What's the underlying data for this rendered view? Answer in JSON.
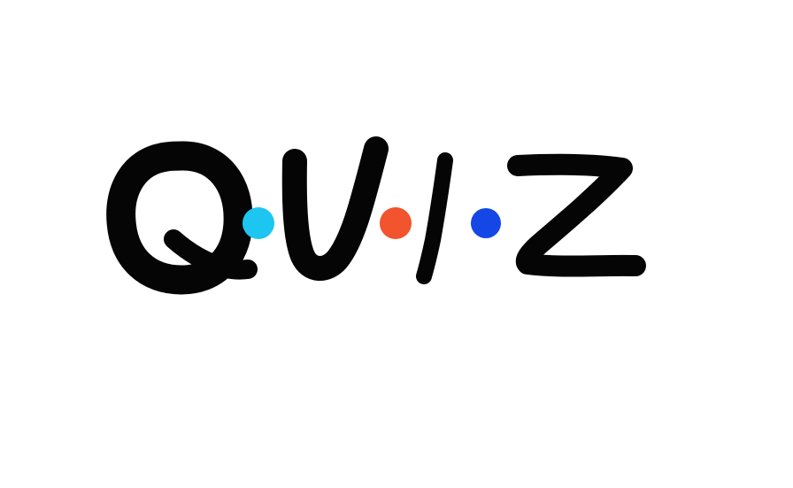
{
  "logo": {
    "text": "QUIZ",
    "letters": [
      "Q",
      "U",
      "I",
      "Z"
    ],
    "ink_color": "#050505",
    "dots": [
      {
        "name": "cyan",
        "color": "#1CC6F0"
      },
      {
        "name": "orange",
        "color": "#F2542D"
      },
      {
        "name": "blue",
        "color": "#1447E6"
      }
    ]
  },
  "background": "#FFFFFF"
}
